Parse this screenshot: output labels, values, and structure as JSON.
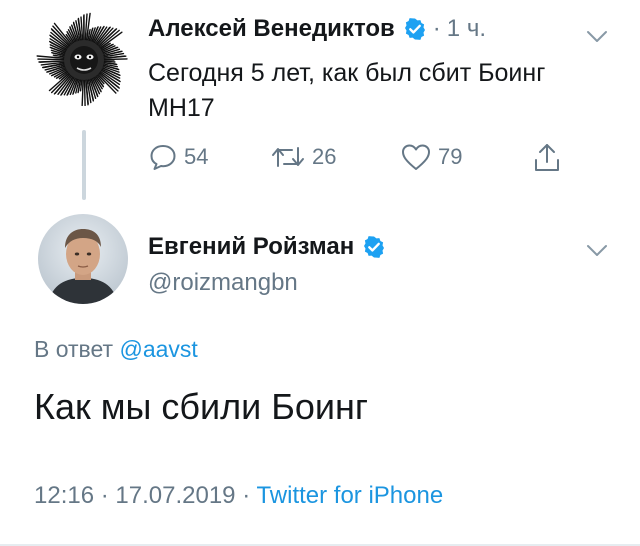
{
  "parent_tweet": {
    "author_name": "Алексей Венедиктов",
    "verified_icon": "verified-badge-icon",
    "separator": "·",
    "time_ago": "1 ч.",
    "text": "Сегодня 5 лет, как был сбит Боинг МН17",
    "actions": {
      "replies": "54",
      "retweets": "26",
      "likes": "79"
    }
  },
  "reply_tweet": {
    "author_name": "Евгений Ройзман",
    "handle": "@roizmangbn",
    "reply_prefix": "В ответ",
    "reply_mention": "@aavst",
    "text": "Как мы сбили Боинг",
    "time": "12:16",
    "separator": "·",
    "date": "17.07.2019",
    "source": "Twitter for iPhone"
  },
  "colors": {
    "text": "#14171a",
    "muted": "#657786",
    "link": "#1b95e0",
    "verified": "#1da1f2",
    "thread_line": "#ccd6dd"
  }
}
